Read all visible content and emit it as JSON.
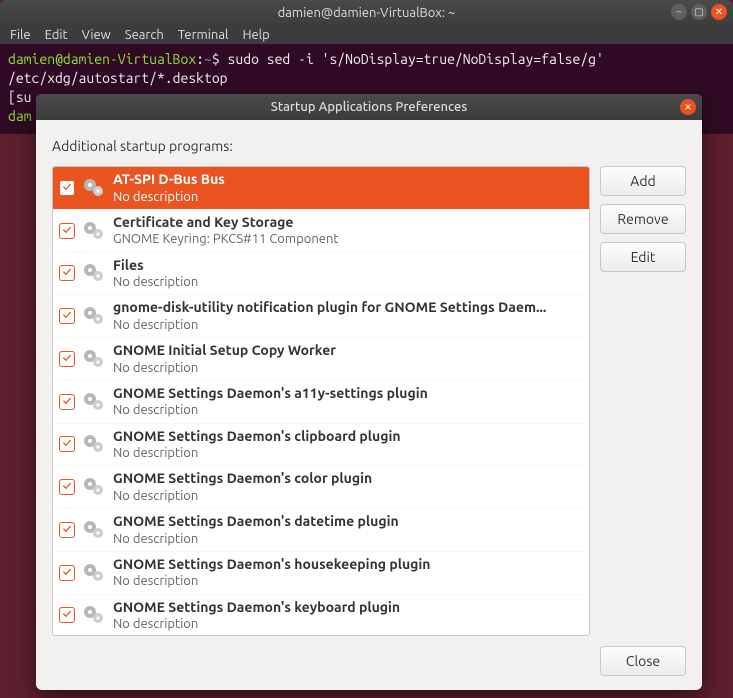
{
  "terminal": {
    "title": "damien@damien-VirtualBox: ~",
    "menu": [
      "File",
      "Edit",
      "View",
      "Search",
      "Terminal",
      "Help"
    ],
    "prompt_user": "damien@damien-VirtualBox",
    "prompt_sep": ":",
    "prompt_path": "~",
    "prompt_sym": "$",
    "cmd": "sudo sed -i 's/NoDisplay=true/NoDisplay=false/g' /etc/xdg/autostart/*.desktop",
    "line2_prefix": "[su",
    "line3_prefix": "dam"
  },
  "dialog": {
    "title": "Startup Applications Preferences",
    "heading": "Additional startup programs:",
    "buttons": {
      "add": "Add",
      "remove": "Remove",
      "edit": "Edit",
      "close": "Close"
    },
    "items": [
      {
        "name": "AT-SPI D-Bus Bus",
        "desc": "No description",
        "checked": true,
        "selected": true
      },
      {
        "name": "Certificate and Key Storage",
        "desc": "GNOME Keyring: PKCS#11 Component",
        "checked": true,
        "selected": false
      },
      {
        "name": "Files",
        "desc": "No description",
        "checked": true,
        "selected": false
      },
      {
        "name": "gnome-disk-utility notification plugin for GNOME Settings Daem...",
        "desc": "No description",
        "checked": true,
        "selected": false
      },
      {
        "name": "GNOME Initial Setup Copy Worker",
        "desc": "No description",
        "checked": true,
        "selected": false
      },
      {
        "name": "GNOME Settings Daemon's a11y-settings plugin",
        "desc": "No description",
        "checked": true,
        "selected": false
      },
      {
        "name": "GNOME Settings Daemon's clipboard plugin",
        "desc": "No description",
        "checked": true,
        "selected": false
      },
      {
        "name": "GNOME Settings Daemon's color plugin",
        "desc": "No description",
        "checked": true,
        "selected": false
      },
      {
        "name": "GNOME Settings Daemon's datetime plugin",
        "desc": "No description",
        "checked": true,
        "selected": false
      },
      {
        "name": "GNOME Settings Daemon's housekeeping plugin",
        "desc": "No description",
        "checked": true,
        "selected": false
      },
      {
        "name": "GNOME Settings Daemon's keyboard plugin",
        "desc": "No description",
        "checked": true,
        "selected": false
      }
    ]
  }
}
